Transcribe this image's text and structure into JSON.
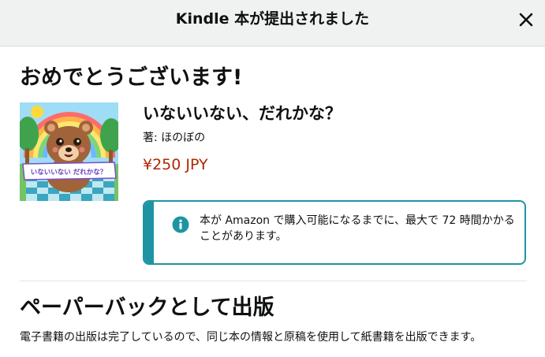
{
  "header": {
    "title": "Kindle 本が提出されました",
    "close_icon": "close-icon"
  },
  "main": {
    "congrats": "おめでとうございます!",
    "book": {
      "title": "いないいない、だれかな？",
      "author": "著: ほのぼの",
      "price": "¥250 JPY",
      "cover_text": "いないいない だれかな？"
    },
    "notice": {
      "icon": "info-icon",
      "text": "本が Amazon で購入可能になるまでに、最大で 72 時間かかることがあります。",
      "accent_color": "#1e94a3"
    },
    "paperback": {
      "heading": "ペーパーバックとして出版",
      "description": "電子書籍の出版は完了しているので、同じ本の情報と原稿を使用して紙書籍を出版できます。"
    }
  },
  "colors": {
    "price": "#b12704",
    "header_bg": "#f0f2f2"
  }
}
